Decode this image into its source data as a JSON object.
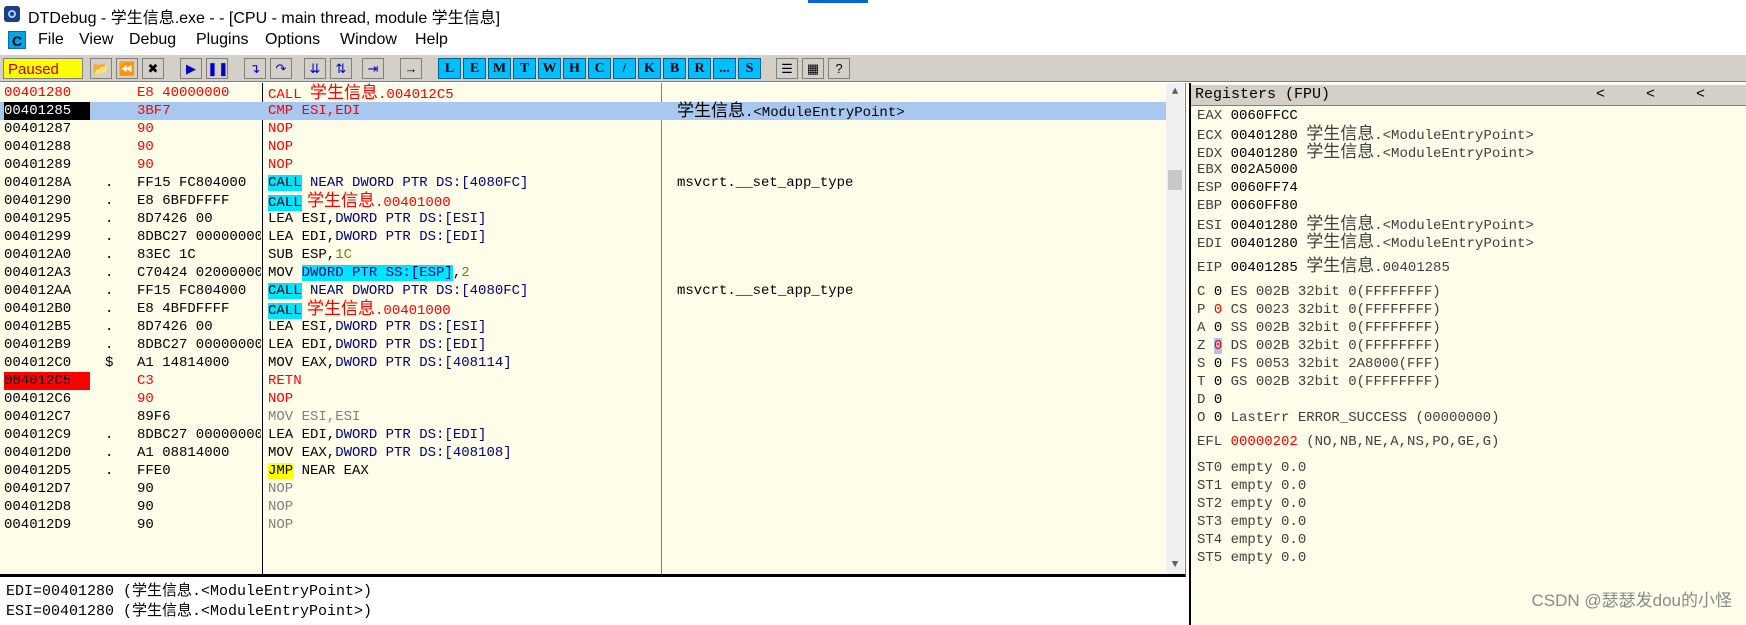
{
  "window": {
    "title": "DTDebug - 学生信息.exe - - [CPU - main thread, module 学生信息]"
  },
  "menu": {
    "c_icon": "C",
    "items": [
      "File",
      "View",
      "Debug",
      "Plugins",
      "Options",
      "Window",
      "Help"
    ]
  },
  "toolbar": {
    "status": "Paused",
    "buttons": [
      "open-icon",
      "restart-icon",
      "close-icon",
      "run-icon",
      "pause-icon",
      "step-into-icon",
      "step-over-icon",
      "trace-into-icon",
      "trace-over-icon",
      "execute-till-return-icon",
      "go-to-cursor-icon"
    ],
    "letters": [
      "L",
      "E",
      "M",
      "T",
      "W",
      "H",
      "C",
      "/",
      "K",
      "B",
      "R",
      "...",
      "S"
    ],
    "extra": [
      "list-icon",
      "grid-icon",
      "?"
    ]
  },
  "disasm": {
    "rows": [
      {
        "addr": "00401280",
        "mark": "",
        "hex": "E8 40000000",
        "ins": [
          "CALL ",
          "学生信息",
          ".004012C5"
        ],
        "cmt": "",
        "addr_style": "hl",
        "hex_style": "red",
        "ins_style": "call_red"
      },
      {
        "addr": "00401285",
        "mark": "",
        "hex": "3BF7",
        "ins": [
          "CMP ESI,EDI"
        ],
        "cmt": "学生信息.<ModuleEntryPoint>",
        "addr_style": "sel",
        "hex_style": "red",
        "ins_style": "red"
      },
      {
        "addr": "00401287",
        "mark": "",
        "hex": "90",
        "ins": [
          "NOP"
        ],
        "cmt": "",
        "addr_style": "",
        "hex_style": "red",
        "ins_style": "red"
      },
      {
        "addr": "00401288",
        "mark": "",
        "hex": "90",
        "ins": [
          "NOP"
        ],
        "cmt": "",
        "addr_style": "",
        "hex_style": "red",
        "ins_style": "red"
      },
      {
        "addr": "00401289",
        "mark": "",
        "hex": "90",
        "ins": [
          "NOP"
        ],
        "cmt": "",
        "addr_style": "",
        "hex_style": "red",
        "ins_style": "red"
      },
      {
        "addr": "0040128A",
        "mark": ".",
        "hex": "FF15 FC804000",
        "ins": [
          "CALL",
          " NEAR DWORD PTR DS:[4080FC]"
        ],
        "cmt": "msvcrt.__set_app_type",
        "addr_style": "",
        "hex_style": "",
        "ins_style": "call_near"
      },
      {
        "addr": "00401290",
        "mark": ".",
        "hex": "E8 6BFDFFFF",
        "ins": [
          "CALL",
          " 学生信息",
          ".00401000"
        ],
        "cmt": "",
        "addr_style": "",
        "hex_style": "",
        "ins_style": "call_cn"
      },
      {
        "addr": "00401295",
        "mark": ".",
        "hex": "8D7426 00",
        "ins": [
          "LEA ESI,",
          "DWORD PTR DS:[ESI]"
        ],
        "cmt": "",
        "addr_style": "",
        "hex_style": "",
        "ins_style": "lea"
      },
      {
        "addr": "00401299",
        "mark": ".",
        "hex": "8DBC27 00000000",
        "ins": [
          "LEA EDI,",
          "DWORD PTR DS:[EDI]"
        ],
        "cmt": "",
        "addr_style": "",
        "hex_style": "",
        "ins_style": "lea"
      },
      {
        "addr": "004012A0",
        "mark": ".",
        "hex": "83EC 1C",
        "ins": [
          "SUB ESP,",
          "1C"
        ],
        "cmt": "",
        "addr_style": "",
        "hex_style": "",
        "ins_style": "sub"
      },
      {
        "addr": "004012A3",
        "mark": ".",
        "hex": "C70424 02000000",
        "ins": [
          "MOV ",
          "DWORD PTR SS:[ESP]",
          ",",
          "2"
        ],
        "cmt": "",
        "addr_style": "",
        "hex_style": "",
        "ins_style": "mov_ss"
      },
      {
        "addr": "004012AA",
        "mark": ".",
        "hex": "FF15 FC804000",
        "ins": [
          "CALL",
          " NEAR DWORD PTR DS:[4080FC]"
        ],
        "cmt": "msvcrt.__set_app_type",
        "addr_style": "",
        "hex_style": "",
        "ins_style": "call_near"
      },
      {
        "addr": "004012B0",
        "mark": ".",
        "hex": "E8 4BFDFFFF",
        "ins": [
          "CALL",
          " 学生信息",
          ".00401000"
        ],
        "cmt": "",
        "addr_style": "",
        "hex_style": "",
        "ins_style": "call_cn"
      },
      {
        "addr": "004012B5",
        "mark": ".",
        "hex": "8D7426 00",
        "ins": [
          "LEA ESI,",
          "DWORD PTR DS:[ESI]"
        ],
        "cmt": "",
        "addr_style": "",
        "hex_style": "",
        "ins_style": "lea"
      },
      {
        "addr": "004012B9",
        "mark": ".",
        "hex": "8DBC27 00000000",
        "ins": [
          "LEA EDI,",
          "DWORD PTR DS:[EDI]"
        ],
        "cmt": "",
        "addr_style": "",
        "hex_style": "",
        "ins_style": "lea"
      },
      {
        "addr": "004012C0",
        "mark": "$",
        "hex": "A1 14814000",
        "ins": [
          "MOV EAX,",
          "DWORD PTR DS:[408114]"
        ],
        "cmt": "",
        "addr_style": "",
        "hex_style": "",
        "ins_style": "lea"
      },
      {
        "addr": "004012C5",
        "mark": "",
        "hex": "C3",
        "ins": [
          "RETN"
        ],
        "cmt": "",
        "addr_style": "bp",
        "hex_style": "red",
        "ins_style": "red"
      },
      {
        "addr": "004012C6",
        "mark": "",
        "hex": "90",
        "ins": [
          "NOP"
        ],
        "cmt": "",
        "addr_style": "",
        "hex_style": "red",
        "ins_style": "red"
      },
      {
        "addr": "004012C7",
        "mark": "",
        "hex": "89F6",
        "ins": [
          "MOV ESI,ESI"
        ],
        "cmt": "",
        "addr_style": "",
        "hex_style": "",
        "ins_style": "grey"
      },
      {
        "addr": "004012C9",
        "mark": ".",
        "hex": "8DBC27 00000000",
        "ins": [
          "LEA EDI,",
          "DWORD PTR DS:[EDI]"
        ],
        "cmt": "",
        "addr_style": "",
        "hex_style": "",
        "ins_style": "lea"
      },
      {
        "addr": "004012D0",
        "mark": ".",
        "hex": "A1 08814000",
        "ins": [
          "MOV EAX,",
          "DWORD PTR DS:[408108]"
        ],
        "cmt": "",
        "addr_style": "",
        "hex_style": "",
        "ins_style": "lea"
      },
      {
        "addr": "004012D5",
        "mark": ".",
        "hex": "FFE0",
        "ins": [
          "JMP",
          " NEAR EAX"
        ],
        "cmt": "",
        "addr_style": "",
        "hex_style": "",
        "ins_style": "jmp"
      },
      {
        "addr": "004012D7",
        "mark": "",
        "hex": "90",
        "ins": [
          "NOP"
        ],
        "cmt": "",
        "addr_style": "",
        "hex_style": "",
        "ins_style": "grey"
      },
      {
        "addr": "004012D8",
        "mark": "",
        "hex": "90",
        "ins": [
          "NOP"
        ],
        "cmt": "",
        "addr_style": "",
        "hex_style": "",
        "ins_style": "grey"
      },
      {
        "addr": "004012D9",
        "mark": "",
        "hex": "90",
        "ins": [
          "NOP"
        ],
        "cmt": "",
        "addr_style": "",
        "hex_style": "",
        "ins_style": "grey"
      }
    ]
  },
  "info": {
    "line1": "EDI=00401280 (学生信息.<ModuleEntryPoint>)",
    "line2": "ESI=00401280 (学生信息.<ModuleEntryPoint>)"
  },
  "registers": {
    "title": "Registers (FPU)",
    "nav": [
      "<",
      "<",
      "<"
    ],
    "general": [
      {
        "name": "EAX",
        "value": "0060FFCC",
        "comment": ""
      },
      {
        "name": "ECX",
        "value": "00401280",
        "comment": "学生信息.<ModuleEntryPoint>"
      },
      {
        "name": "EDX",
        "value": "00401280",
        "comment": "学生信息.<ModuleEntryPoint>"
      },
      {
        "name": "EBX",
        "value": "002A5000",
        "comment": ""
      },
      {
        "name": "ESP",
        "value": "0060FF74",
        "comment": ""
      },
      {
        "name": "EBP",
        "value": "0060FF80",
        "comment": ""
      },
      {
        "name": "ESI",
        "value": "00401280",
        "comment": "学生信息.<ModuleEntryPoint>"
      },
      {
        "name": "EDI",
        "value": "00401280",
        "comment": "学生信息.<ModuleEntryPoint>"
      }
    ],
    "eip": {
      "name": "EIP",
      "value": "00401285",
      "comment": "学生信息.00401285"
    },
    "flags": [
      {
        "flag": "C",
        "val": "0",
        "seg": "ES 002B 32bit 0(FFFFFFFF)",
        "style": ""
      },
      {
        "flag": "P",
        "val": "0",
        "seg": "CS 0023 32bit 0(FFFFFFFF)",
        "style": "red"
      },
      {
        "flag": "A",
        "val": "0",
        "seg": "SS 002B 32bit 0(FFFFFFFF)",
        "style": ""
      },
      {
        "flag": "Z",
        "val": "0",
        "seg": "DS 002B 32bit 0(FFFFFFFF)",
        "style": "sel"
      },
      {
        "flag": "S",
        "val": "0",
        "seg": "FS 0053 32bit 2A8000(FFF)",
        "style": ""
      },
      {
        "flag": "T",
        "val": "0",
        "seg": "GS 002B 32bit 0(FFFFFFFF)",
        "style": ""
      },
      {
        "flag": "D",
        "val": "0",
        "seg": "",
        "style": ""
      },
      {
        "flag": "O",
        "val": "0",
        "seg": "LastErr ERROR_SUCCESS (00000000)",
        "style": ""
      }
    ],
    "efl": {
      "name": "EFL",
      "value": "00000202",
      "desc": "(NO,NB,NE,A,NS,PO,GE,G)"
    },
    "fpu": [
      "ST0 empty 0.0",
      "ST1 empty 0.0",
      "ST2 empty 0.0",
      "ST3 empty 0.0",
      "ST4 empty 0.0",
      "ST5 empty 0.0"
    ]
  },
  "watermark": "CSDN @瑟瑟发dou的小怪",
  "colors": {
    "pane_bg": "#fdfde9",
    "selected_row": "#a9c8ef",
    "breakpoint": "#ff0000",
    "call_highlight": "#00e5ff",
    "jmp_highlight": "#ffff00",
    "status_bg": "#ffff00"
  }
}
